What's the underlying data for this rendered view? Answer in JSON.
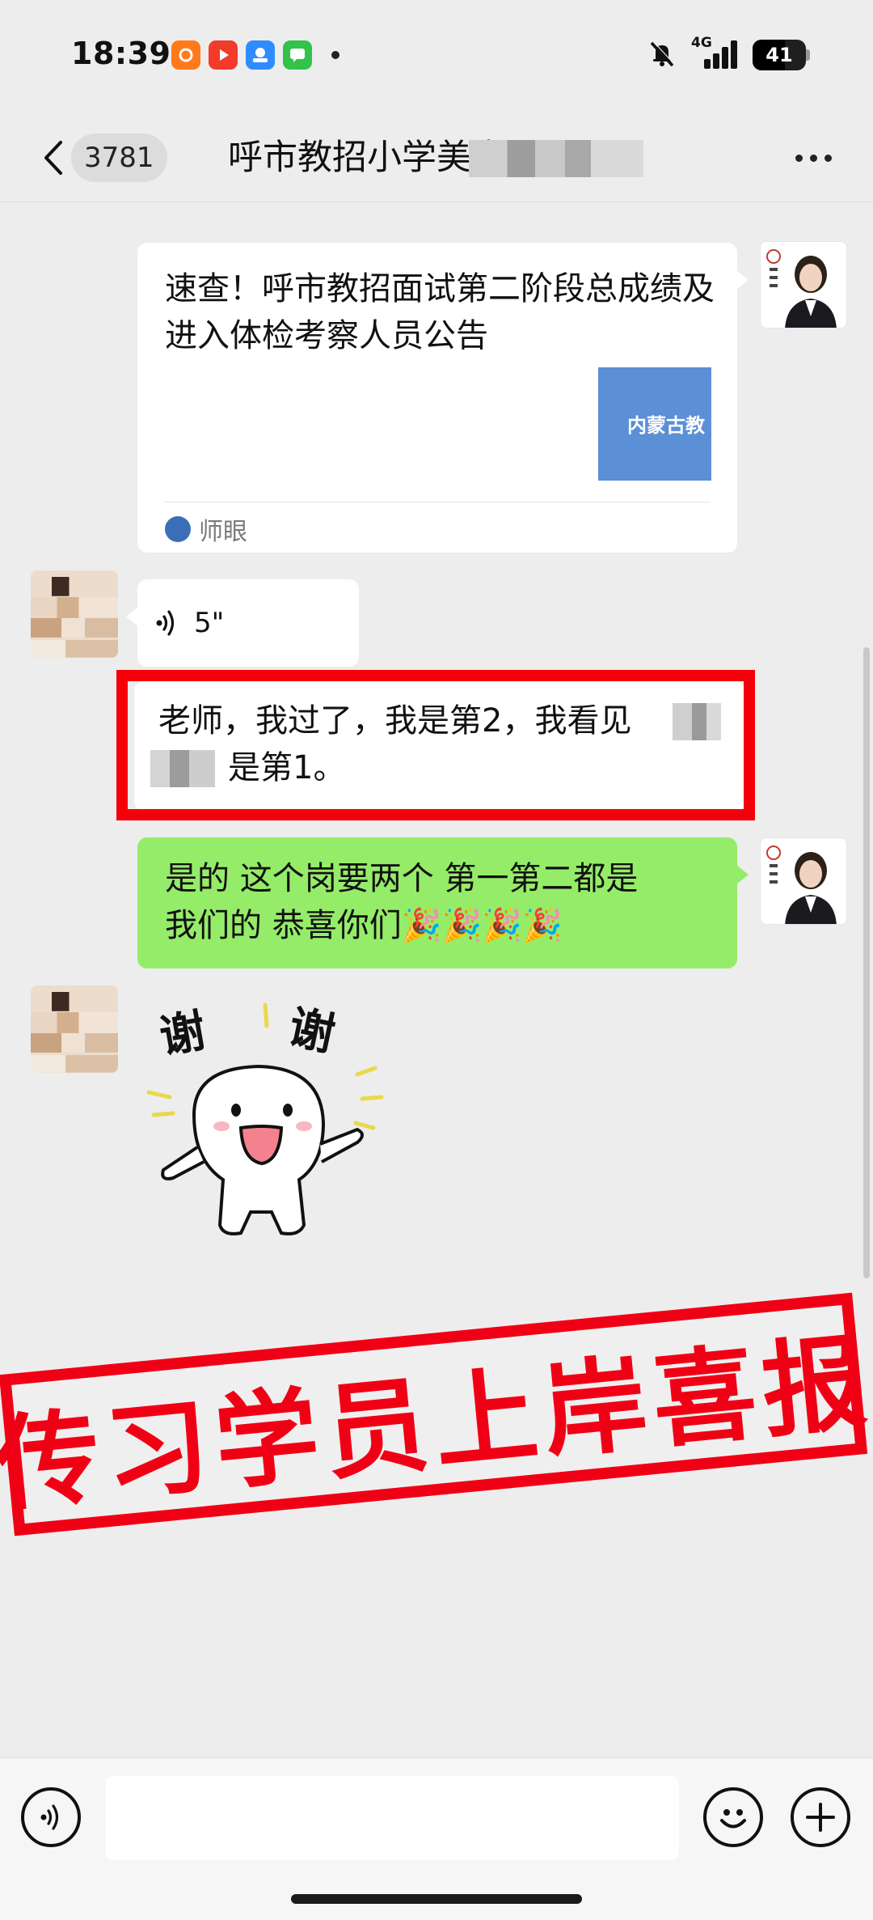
{
  "status_bar": {
    "time": "18:39",
    "network": "4G",
    "battery": "41",
    "app_icons": [
      "orange-app-icon",
      "red-video-app-icon",
      "blue-cloud-app-icon",
      "green-message-app-icon"
    ],
    "indicator_icons": [
      "mute-bell-icon",
      "signal-bars-icon"
    ]
  },
  "nav": {
    "unread_count": "3781",
    "title_visible": "呼市教招小学美术"
  },
  "messages": {
    "article_card": {
      "title": "速查！呼市教招面试第二阶段总成绩及进入体检考察人员公告",
      "thumbnail_text": "内蒙古教",
      "source": "师眼"
    },
    "voice": {
      "duration": "5\""
    },
    "student_text": {
      "line1": "老师，我过了，我是第2，我看见",
      "line2": "是第1。"
    },
    "teacher_reply": {
      "line1": "是的 这个岗要两个  第一第二都是",
      "line2": "我们的  恭喜你们🎉🎉🎉🎉"
    },
    "sticker": {
      "text_left": "谢",
      "text_right": "谢"
    }
  },
  "overlay": {
    "stamp_text": "传习学员上岸喜报",
    "stamp_color": "#f00014"
  },
  "colors": {
    "background": "#ededed",
    "own_bubble": "#95ec69",
    "other_bubble": "#ffffff",
    "highlight_frame": "#f4000a"
  }
}
